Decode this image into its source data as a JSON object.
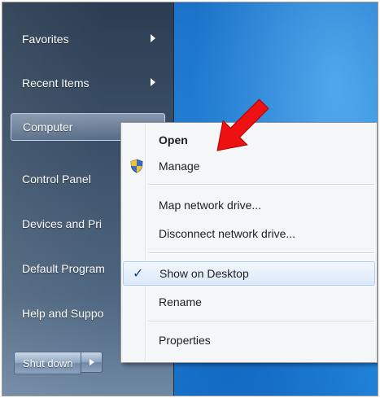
{
  "start_menu": {
    "items": [
      {
        "label": "Favorites",
        "has_submenu": true
      },
      {
        "label": "Recent Items",
        "has_submenu": true
      },
      {
        "label": "Computer",
        "has_submenu": false,
        "highlighted": true
      },
      {
        "label": "Control Panel",
        "has_submenu": false
      },
      {
        "label": "Devices and Pri",
        "has_submenu": false
      },
      {
        "label": "Default Program",
        "has_submenu": false
      },
      {
        "label": "Help and Suppo",
        "has_submenu": false
      }
    ],
    "shutdown_label": "Shut down"
  },
  "context_menu": {
    "items": [
      {
        "label": "Open",
        "bold": true
      },
      {
        "label": "Manage",
        "icon": "uac-shield-icon"
      },
      {
        "label": "Map network drive..."
      },
      {
        "label": "Disconnect network drive..."
      },
      {
        "label": "Show on Desktop",
        "checked": true,
        "hover": true
      },
      {
        "label": "Rename"
      },
      {
        "label": "Properties"
      }
    ]
  },
  "annotation": {
    "arrow_color": "#ee1111",
    "points_to": "Manage"
  },
  "colors": {
    "desktop": "#1f7fd6",
    "start_panel": "#3c526a",
    "menu_bg": "#f5f6f7",
    "hover_border": "#aecff7"
  }
}
